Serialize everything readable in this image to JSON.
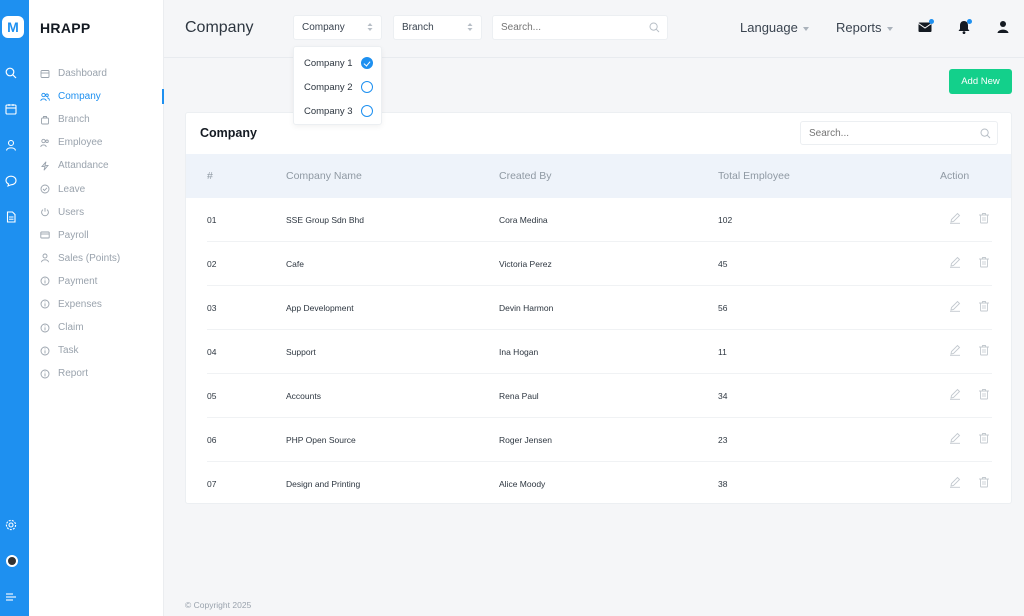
{
  "app": {
    "brand": "HRAPP",
    "logo_letter": "M"
  },
  "sidebar": {
    "items": [
      {
        "label": "Dashboard",
        "icon": "dashboard-icon",
        "active": false
      },
      {
        "label": "Company",
        "icon": "users-icon",
        "active": true
      },
      {
        "label": "Branch",
        "icon": "branch-icon",
        "active": false
      },
      {
        "label": "Employee",
        "icon": "employee-icon",
        "active": false
      },
      {
        "label": "Attandance",
        "icon": "bolt-icon",
        "active": false
      },
      {
        "label": "Leave",
        "icon": "check-circle-icon",
        "active": false
      },
      {
        "label": "Users",
        "icon": "power-icon",
        "active": false
      },
      {
        "label": "Payroll",
        "icon": "card-icon",
        "active": false
      },
      {
        "label": "Sales (Points)",
        "icon": "user-icon",
        "active": false
      },
      {
        "label": "Payment",
        "icon": "info-icon",
        "active": false
      },
      {
        "label": "Expenses",
        "icon": "info-icon",
        "active": false
      },
      {
        "label": "Claim",
        "icon": "info-icon",
        "active": false
      },
      {
        "label": "Task",
        "icon": "info-icon",
        "active": false
      },
      {
        "label": "Report",
        "icon": "info-icon",
        "active": false
      }
    ]
  },
  "header": {
    "title": "Company",
    "company_select": "Company",
    "branch_select": "Branch",
    "search_placeholder": "Search...",
    "language": "Language",
    "reports": "Reports"
  },
  "company_dropdown": {
    "options": [
      {
        "label": "Company 1",
        "checked": true
      },
      {
        "label": "Company 2",
        "checked": false
      },
      {
        "label": "Company 3",
        "checked": false
      }
    ]
  },
  "actions": {
    "add_new": "Add New"
  },
  "table": {
    "title": "Company",
    "search_placeholder": "Search...",
    "columns": [
      "#",
      "Company Name",
      "Created By",
      "Total Employee",
      "Action"
    ],
    "rows": [
      {
        "no": "01",
        "name": "SSE Group Sdn Bhd",
        "created_by": "Cora Medina",
        "total": "102"
      },
      {
        "no": "02",
        "name": "Cafe",
        "created_by": "Victoria Perez",
        "total": "45"
      },
      {
        "no": "03",
        "name": "App Development",
        "created_by": "Devin Harmon",
        "total": "56"
      },
      {
        "no": "04",
        "name": "Support",
        "created_by": "Ina Hogan",
        "total": "11"
      },
      {
        "no": "05",
        "name": "Accounts",
        "created_by": "Rena Paul",
        "total": "34"
      },
      {
        "no": "06",
        "name": "PHP Open Source",
        "created_by": "Roger Jensen",
        "total": "23"
      },
      {
        "no": "07",
        "name": "Design and Printing",
        "created_by": "Alice Moody",
        "total": "38"
      }
    ]
  },
  "footer": {
    "copyright": "© Copyright 2025"
  },
  "colors": {
    "primary": "#1e90f0",
    "success": "#13d08b",
    "table_header_bg": "#eef3fa"
  }
}
